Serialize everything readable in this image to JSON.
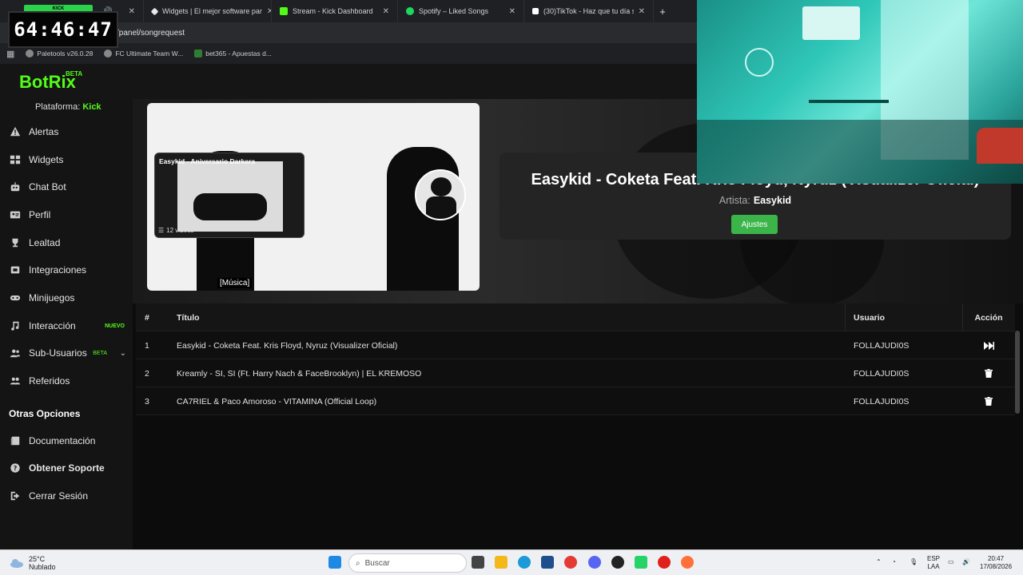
{
  "browser": {
    "tabs": [
      {
        "label": "",
        "color": "#2bd34a"
      },
      {
        "label": "Widgets | El mejor software par",
        "color": "#e8e8e8"
      },
      {
        "label": "Stream - Kick Dashboard",
        "color": "#53fc18"
      },
      {
        "label": "Spotify – Liked Songs",
        "color": "#1ed760"
      },
      {
        "label": "(30)TikTok - Haz que tu día sea",
        "color": "#ffffff"
      }
    ],
    "url": "/panel/songrequest",
    "bookmarks": [
      "Paletools v26.0.28",
      "FC Ultimate Team W...",
      "bet365 - Apuestas d..."
    ]
  },
  "overlay": {
    "timer": "64:46:47",
    "timer_label": "KICK"
  },
  "app": {
    "logo": "BotRix",
    "logo_badge": "BETA",
    "platform_label": "Plataforma:",
    "platform_value": "Kick"
  },
  "sidebar": {
    "items": [
      {
        "label": "Alertas",
        "icon": "warning-icon"
      },
      {
        "label": "Widgets",
        "icon": "grid-icon"
      },
      {
        "label": "Chat Bot",
        "icon": "robot-icon"
      },
      {
        "label": "Perfil",
        "icon": "id-card-icon"
      },
      {
        "label": "Lealtad",
        "icon": "trophy-icon"
      },
      {
        "label": "Integraciones",
        "icon": "plug-icon"
      },
      {
        "label": "Minijuegos",
        "icon": "gamepad-icon"
      },
      {
        "label": "Interacción",
        "icon": "music-icon",
        "badge": "NUEVO"
      },
      {
        "label": "Sub-Usuarios",
        "icon": "users-icon",
        "badge": "BETA"
      },
      {
        "label": "Referidos",
        "icon": "user-group-icon"
      }
    ],
    "section_title": "Otras Opciones",
    "other_items": [
      {
        "label": "Documentación",
        "icon": "book-icon"
      },
      {
        "label": "Obtener Soporte",
        "icon": "help-icon"
      },
      {
        "label": "Cerrar Sesión",
        "icon": "logout-icon"
      }
    ]
  },
  "player": {
    "playlist_title": "Easykid - Aniversario Darkera",
    "playlist_count": "12 videos",
    "caption": "[Música]",
    "now_playing_title": "Easykid - Coketa Feat. Kris Floyd, Nyruz (Visualizer Oficial)",
    "artist_label": "Artista:",
    "artist": "Easykid",
    "settings_button": "Ajustes"
  },
  "queue": {
    "headers": {
      "num": "#",
      "title": "Título",
      "user": "Usuario",
      "action": "Acción"
    },
    "rows": [
      {
        "num": "1",
        "title": "Easykid - Coketa Feat. Kris Floyd, Nyruz (Visualizer Oficial)",
        "user": "FOLLAJUDI0S",
        "action": "skip"
      },
      {
        "num": "2",
        "title": "Kreamly - SI, SI (Ft. Harry Nach & FaceBrooklyn) | EL KREMOSO",
        "user": "FOLLAJUDI0S",
        "action": "delete"
      },
      {
        "num": "3",
        "title": "CA7RIEL & Paco Amoroso - VITAMINA (Official Loop)",
        "user": "FOLLAJUDI0S",
        "action": "delete"
      }
    ]
  },
  "taskbar": {
    "temp": "25°C",
    "weather": "Nublado",
    "search_placeholder": "Buscar",
    "lang_top": "ESP",
    "lang_bottom": "LAA",
    "time": "20:47",
    "date": "17/08/2026"
  },
  "colors": {
    "accent": "#53fc18",
    "button": "#3bb54a"
  }
}
